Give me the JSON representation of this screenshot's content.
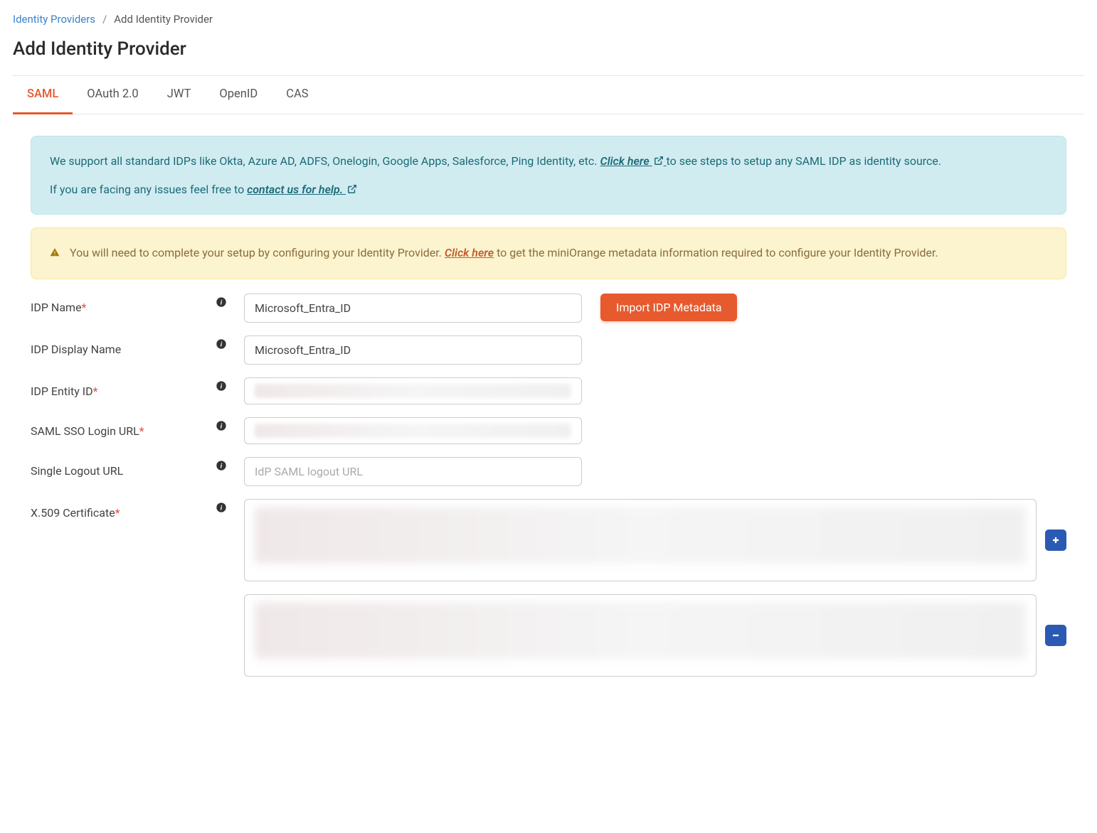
{
  "breadcrumb": {
    "root": "Identity Providers",
    "current": "Add Identity Provider"
  },
  "page_title": "Add Identity Provider",
  "tabs": [
    {
      "label": "SAML",
      "active": true
    },
    {
      "label": "OAuth 2.0",
      "active": false
    },
    {
      "label": "JWT",
      "active": false
    },
    {
      "label": "OpenID",
      "active": false
    },
    {
      "label": "CAS",
      "active": false
    }
  ],
  "info_alert": {
    "text_1": "We support all standard IDPs like Okta, Azure AD, ADFS, Onelogin, Google Apps, Salesforce, Ping Identity, etc. ",
    "link_1": "Click here",
    "text_2": " to see steps to setup any SAML IDP as identity source.",
    "text_3": "If you are facing any issues feel free to ",
    "link_2": "contact us for help."
  },
  "warning_alert": {
    "text_1": "You will need to complete your setup by configuring your Identity Provider. ",
    "link_1": "Click here",
    "text_2": " to get the miniOrange metadata information required to configure your Identity Provider."
  },
  "form": {
    "idp_name": {
      "label": "IDP Name",
      "value": "Microsoft_Entra_ID",
      "required": true
    },
    "idp_display_name": {
      "label": "IDP Display Name",
      "value": "Microsoft_Entra_ID",
      "required": false
    },
    "idp_entity_id": {
      "label": "IDP Entity ID",
      "value": "",
      "required": true
    },
    "saml_sso_login_url": {
      "label": "SAML SSO Login URL",
      "value": "",
      "required": true
    },
    "single_logout_url": {
      "label": "Single Logout URL",
      "placeholder": "IdP SAML logout URL",
      "value": "",
      "required": false
    },
    "x509_certificate": {
      "label": "X.509 Certificate",
      "required": true
    },
    "import_button": "Import IDP Metadata"
  }
}
